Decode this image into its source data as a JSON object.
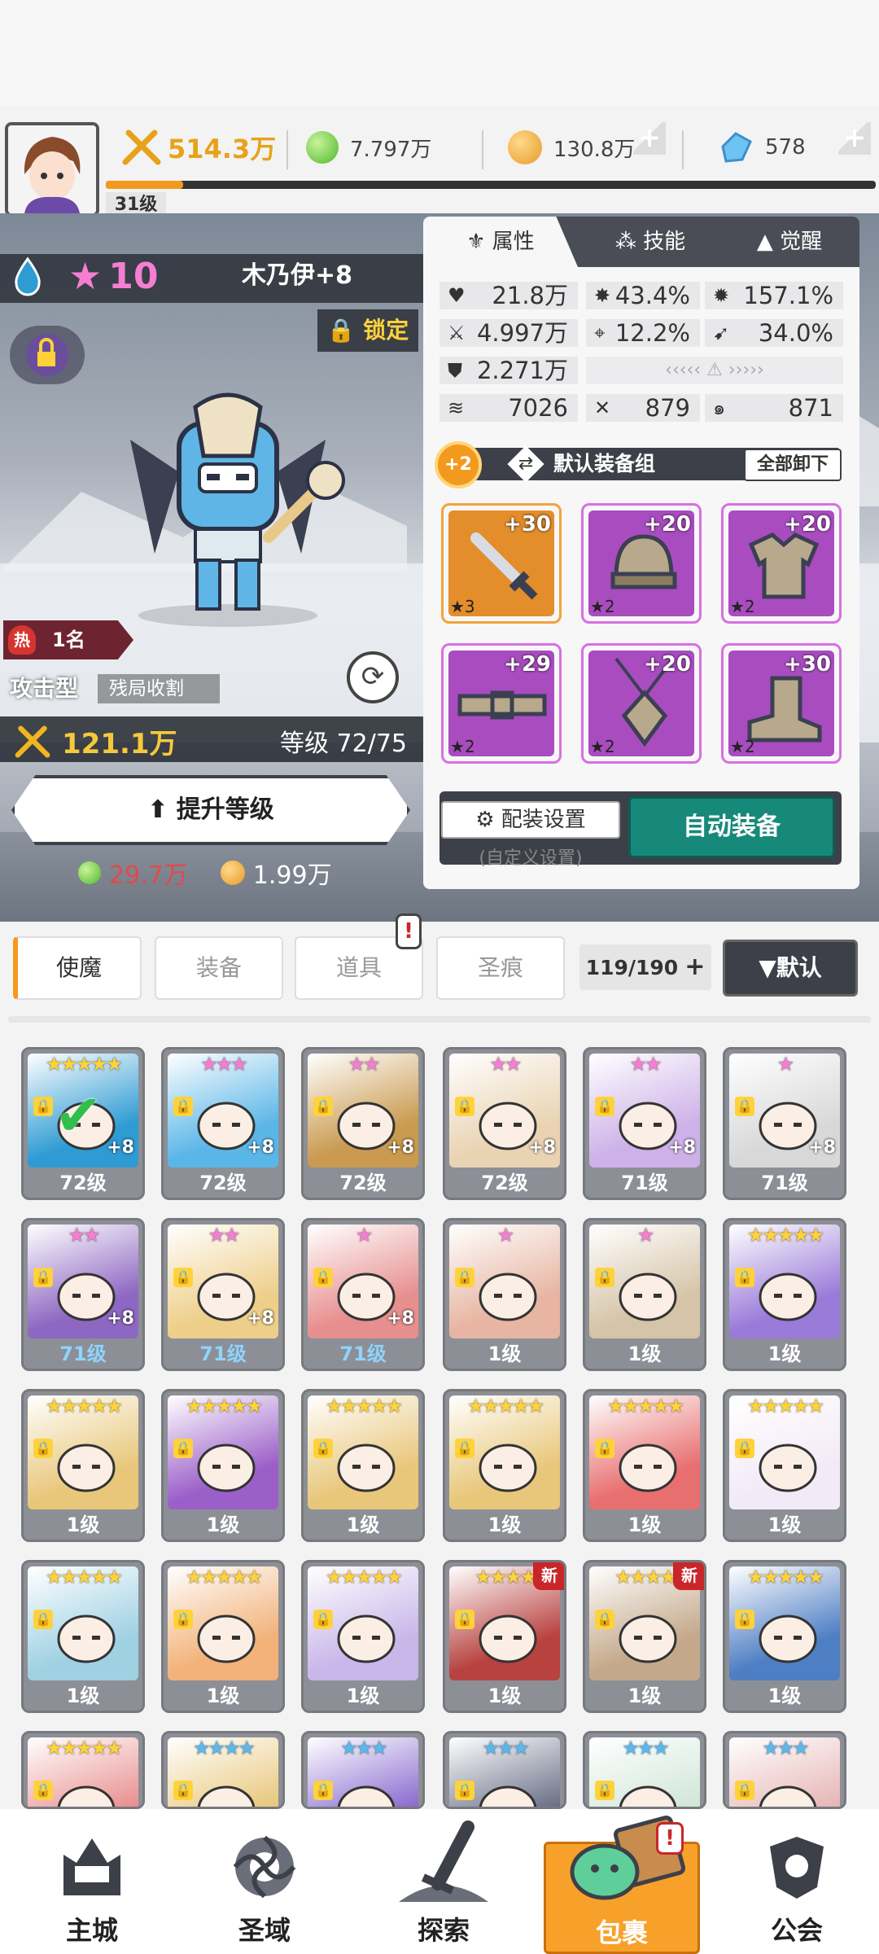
{
  "header": {
    "player_level": "31级",
    "power": "514.3万",
    "resources": [
      {
        "name": "green-orb",
        "value": "7.797万"
      },
      {
        "name": "gold-coin",
        "value": "130.8万"
      },
      {
        "name": "crystal",
        "value": "578"
      }
    ]
  },
  "hero": {
    "element_icon": "water-drop-icon",
    "star_count": "10",
    "name": "木乃伊+8",
    "lock_label": "锁定",
    "rank_badge": "热",
    "rank": "1名",
    "type": "攻击型",
    "tag": "残局收割",
    "power": "121.1万",
    "level_text": "等级 72/75",
    "upgrade_label": "提升等级",
    "cost_green": "29.7万",
    "cost_gold": "1.99万"
  },
  "panel": {
    "tabs": [
      "属性",
      "技能",
      "觉醒"
    ],
    "stats": {
      "hp": "21.8万",
      "crit": "43.4%",
      "crit_dmg": "157.1%",
      "atk": "4.997万",
      "hit": "12.2%",
      "speed": "34.0%",
      "def": "2.271万",
      "s1": "7026",
      "s2": "879",
      "s3": "871"
    },
    "equip_set_badge": "+2",
    "equip_set_name": "默认装备组",
    "unequip_all": "全部卸下",
    "equipment": [
      {
        "item": "sword",
        "plus": "+30",
        "stars": "★3"
      },
      {
        "item": "helmet",
        "plus": "+20",
        "stars": "★2"
      },
      {
        "item": "armor",
        "plus": "+20",
        "stars": "★2"
      },
      {
        "item": "belt",
        "plus": "+29",
        "stars": "★2"
      },
      {
        "item": "amulet",
        "plus": "+20",
        "stars": "★2"
      },
      {
        "item": "boots",
        "plus": "+30",
        "stars": "★2"
      }
    ],
    "config_label": "配装设置",
    "config_sub": "(自定义设置)",
    "auto_equip": "自动装备"
  },
  "filters": {
    "tabs": [
      "使魔",
      "装备",
      "道具",
      "圣痕"
    ],
    "count": "119/190",
    "sort_label": "▼默认"
  },
  "roster": [
    {
      "level": "72级",
      "stars": "★★★★★",
      "plus": "+8",
      "blue": false,
      "color": "#2e9bd3",
      "selected": true
    },
    {
      "level": "72级",
      "stars": "★★★",
      "plus": "+8",
      "blue": false,
      "color": "#5bb6e8"
    },
    {
      "level": "72级",
      "stars": "★★",
      "plus": "+8",
      "blue": false,
      "color": "#c99a4f"
    },
    {
      "level": "72级",
      "stars": "★★",
      "plus": "+8",
      "blue": false,
      "color": "#e9d3b2"
    },
    {
      "level": "71级",
      "stars": "★★",
      "plus": "+8",
      "blue": false,
      "color": "#cdb1e8"
    },
    {
      "level": "71级",
      "stars": "★",
      "plus": "+8",
      "blue": false,
      "color": "#d8d8d8"
    },
    {
      "level": "71级",
      "stars": "★★",
      "plus": "+8",
      "blue": true,
      "color": "#8e67c2"
    },
    {
      "level": "71级",
      "stars": "★★",
      "plus": "+8",
      "blue": true,
      "color": "#eecf8a"
    },
    {
      "level": "71级",
      "stars": "★",
      "plus": "+8",
      "blue": true,
      "color": "#e78f8f"
    },
    {
      "level": "1级",
      "stars": "★",
      "plus": "",
      "blue": false,
      "color": "#e7b5a2"
    },
    {
      "level": "1级",
      "stars": "★",
      "plus": "",
      "blue": false,
      "color": "#d6c4a8"
    },
    {
      "level": "1级",
      "stars": "★★★★★",
      "plus": "",
      "blue": false,
      "color": "#9a7bd9"
    },
    {
      "level": "1级",
      "stars": "★★★★★",
      "plus": "",
      "blue": false,
      "color": "#e8c77a"
    },
    {
      "level": "1级",
      "stars": "★★★★★",
      "plus": "",
      "blue": false,
      "color": "#9b5fc9"
    },
    {
      "level": "1级",
      "stars": "★★★★★",
      "plus": "",
      "blue": false,
      "color": "#e8c77a"
    },
    {
      "level": "1级",
      "stars": "★★★★★",
      "plus": "",
      "blue": false,
      "color": "#e8c77a"
    },
    {
      "level": "1级",
      "stars": "★★★★★",
      "plus": "",
      "blue": false,
      "color": "#e86f6f"
    },
    {
      "level": "1级",
      "stars": "★★★★★",
      "plus": "",
      "blue": false,
      "color": "#f3eaf7"
    },
    {
      "level": "1级",
      "stars": "★★★★★",
      "plus": "",
      "blue": false,
      "color": "#9fd1e3"
    },
    {
      "level": "1级",
      "stars": "★★★★★",
      "plus": "",
      "blue": false,
      "color": "#f2b27a"
    },
    {
      "level": "1级",
      "stars": "★★★★★",
      "plus": "",
      "blue": false,
      "color": "#c9b7ea"
    },
    {
      "level": "1级",
      "stars": "★★★★",
      "plus": "",
      "blue": false,
      "color": "#b7423f",
      "new": "新"
    },
    {
      "level": "1级",
      "stars": "★★★★",
      "plus": "",
      "blue": false,
      "color": "#c4a88a",
      "new": "新"
    },
    {
      "level": "1级",
      "stars": "★★★★★",
      "plus": "",
      "blue": false,
      "color": "#4e7ec4"
    },
    {
      "level": "",
      "stars": "★★★★★",
      "plus": "",
      "blue": false,
      "color": "#e98f8f"
    },
    {
      "level": "",
      "stars": "★★★★",
      "plus": "",
      "blue": false,
      "color": "#e8c77a"
    },
    {
      "level": "",
      "stars": "★★★",
      "plus": "",
      "blue": false,
      "color": "#8a6bd0"
    },
    {
      "level": "",
      "stars": "★★★",
      "plus": "",
      "blue": false,
      "color": "#6a6f86"
    },
    {
      "level": "",
      "stars": "★★★",
      "plus": "",
      "blue": false,
      "color": "#d0e6d8"
    },
    {
      "level": "",
      "stars": "★★★",
      "plus": "",
      "blue": false,
      "color": "#e7b5b5"
    }
  ],
  "nav": [
    {
      "label": "主城",
      "icon": "castle-icon"
    },
    {
      "label": "圣域",
      "icon": "portal-icon"
    },
    {
      "label": "探索",
      "icon": "sword-icon"
    },
    {
      "label": "包裹",
      "icon": "bag-icon",
      "active": true
    },
    {
      "label": "公会",
      "icon": "guild-icon"
    }
  ]
}
